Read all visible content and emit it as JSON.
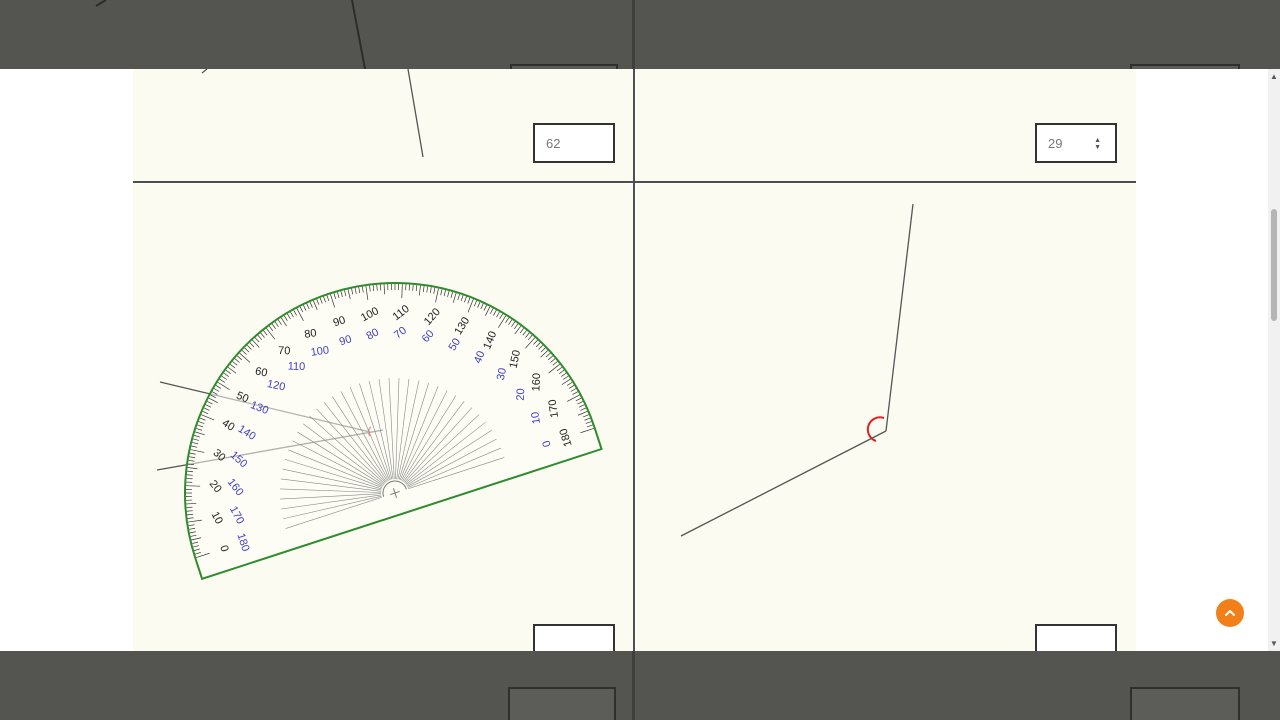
{
  "answers": {
    "top_left_value": "62",
    "top_right_value": "29",
    "bottom_left_value": "",
    "bottom_right_value": ""
  },
  "protractor": {
    "outer_scale": [
      "0",
      "10",
      "20",
      "30",
      "40",
      "50",
      "60",
      "70",
      "80",
      "90",
      "100",
      "110",
      "120",
      "130",
      "140",
      "150",
      "160",
      "170",
      "180"
    ],
    "inner_scale": [
      "180",
      "170",
      "160",
      "150",
      "140",
      "130",
      "120",
      "110",
      "100",
      "90",
      "80",
      "70",
      "60",
      "50",
      "40",
      "30",
      "20",
      "10",
      "0"
    ]
  },
  "icons": {
    "back_to_top": "chevron-up-icon",
    "spinner": "spin-arrows-icon",
    "scroll_up": "triangle-up-icon",
    "scroll_down": "triangle-down-icon"
  },
  "colors": {
    "protractor_edge": "#2e8b2e",
    "inner_scale": "#4040c8",
    "angle_arc": "#e02020",
    "back_to_top": "#f2801a"
  }
}
